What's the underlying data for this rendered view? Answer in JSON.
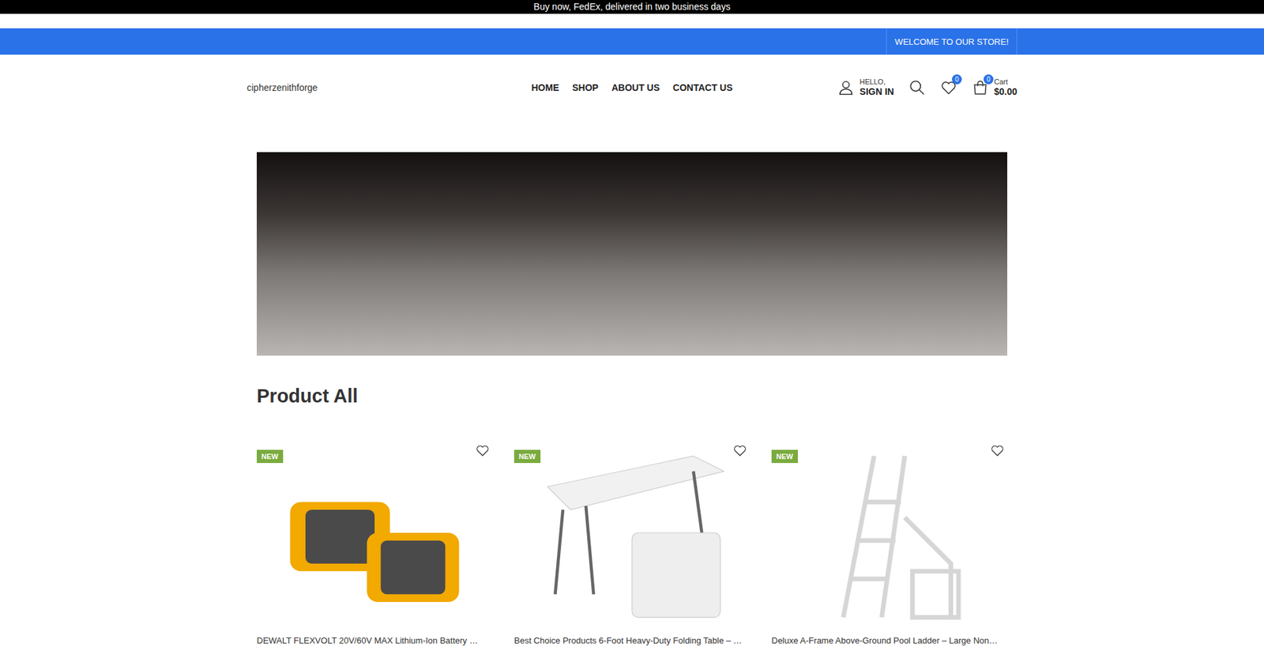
{
  "announcement": "Buy now, FedEx, delivered in two business days",
  "welcome": "WELCOME TO OUR STORE!",
  "logo": "cipherzenithforge",
  "nav": [
    {
      "label": "HOME"
    },
    {
      "label": "SHOP"
    },
    {
      "label": "ABOUT US"
    },
    {
      "label": "CONTACT US"
    }
  ],
  "account": {
    "greeting": "HELLO,",
    "action": "SIGN IN"
  },
  "wishlist": {
    "count": "0"
  },
  "cart": {
    "count": "0",
    "label": "Cart",
    "total": "$0.00"
  },
  "section_title": "Product All",
  "products": [
    {
      "badge": "NEW",
      "title": "DEWALT FLEXVOLT 20V/60V MAX Lithium-Ion Battery …",
      "kind": "battery",
      "favorite": false
    },
    {
      "badge": "NEW",
      "title": "Best Choice Products 6-Foot Heavy-Duty Folding Table – …",
      "kind": "table",
      "favorite": false
    },
    {
      "badge": "NEW",
      "title": "Deluxe A-Frame Above-Ground Pool Ladder – Large Non…",
      "kind": "ladder",
      "favorite": false
    }
  ]
}
